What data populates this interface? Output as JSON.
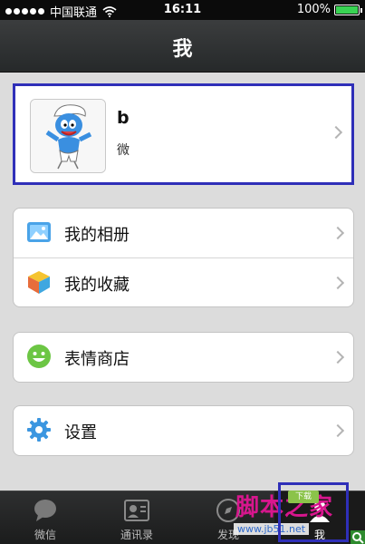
{
  "status_bar": {
    "carrier": "中国联通",
    "time": "16:11",
    "battery": "100%",
    "battery_level": 1.0
  },
  "header": {
    "title": "我"
  },
  "profile": {
    "name": "b",
    "wechat_id_label": "微"
  },
  "menu": {
    "album": "我的相册",
    "favorites": "我的收藏",
    "sticker_store": "表情商店",
    "settings": "设置"
  },
  "tabs": [
    {
      "label": "微信",
      "icon": "chat-bubble-icon"
    },
    {
      "label": "通讯录",
      "icon": "contacts-card-icon"
    },
    {
      "label": "发现",
      "icon": "compass-icon"
    },
    {
      "label": "我",
      "icon": "person-icon"
    }
  ],
  "watermark": {
    "site_name": "脚本之家",
    "url": "www.jb51.net",
    "badge": "下载"
  },
  "colors": {
    "highlight_border": "#2f2fb8",
    "battery": "#39d353",
    "watermark": "#d8168e"
  }
}
